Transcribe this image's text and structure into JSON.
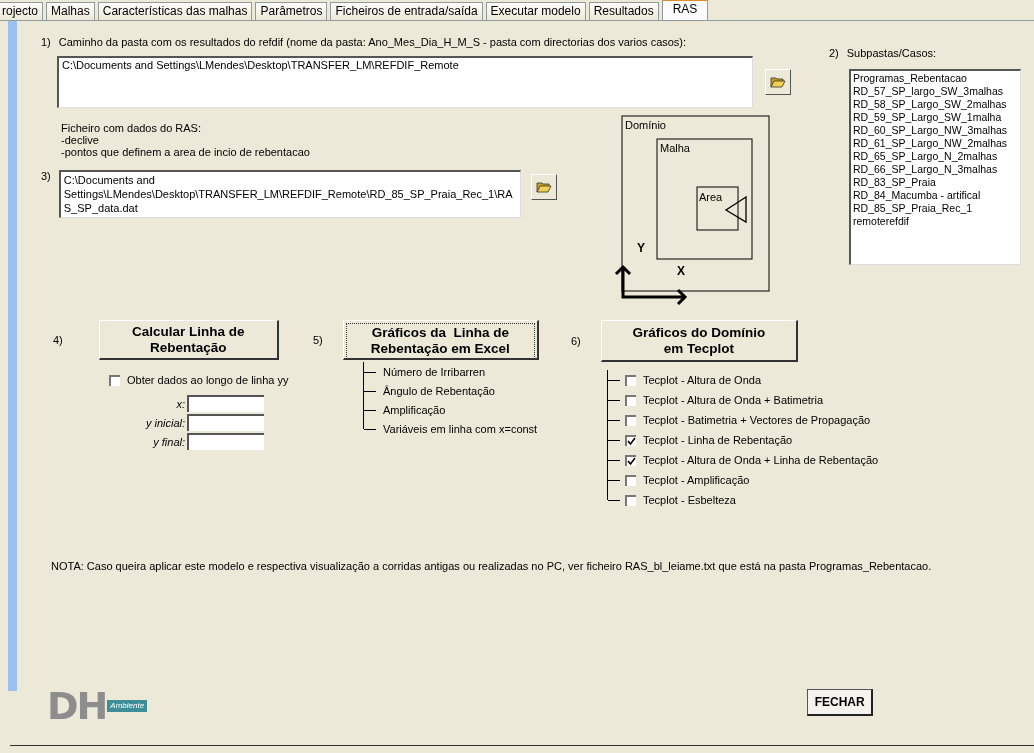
{
  "tabs": [
    {
      "label": "rojecto",
      "selected": false
    },
    {
      "label": "Malhas",
      "selected": false
    },
    {
      "label": "Características das malhas",
      "selected": false
    },
    {
      "label": "Parâmetros",
      "selected": false
    },
    {
      "label": "Ficheiros de entrada/saída",
      "selected": false
    },
    {
      "label": "Executar modelo",
      "selected": false
    },
    {
      "label": "Resultados",
      "selected": false
    },
    {
      "label": "RAS",
      "selected": true
    }
  ],
  "step1": {
    "number": "1)",
    "label": "Caminho da pasta com os resultados do refdif (nome da pasta:  Ano_Mes_Dia_H_M_S - pasta com directorias dos varios casos):",
    "value": "C:\\Documents and Settings\\LMendes\\Desktop\\TRANSFER_LM\\REFDIF_Remote"
  },
  "step2": {
    "number": "2)",
    "label": "Subpastas/Casos:",
    "items": [
      "Programas_Rebentacao",
      "RD_57_SP_largo_SW_3malhas",
      "RD_58_SP_Largo_SW_2malhas",
      "RD_59_SP_Largo_SW_1malha",
      "RD_60_SP_Largo_NW_3malhas",
      "RD_61_SP_Largo_NW_2malhas",
      "RD_65_SP_Largo_N_2malhas",
      "RD_66_SP_Largo_N_3malhas",
      "RD_83_SP_Praia",
      "RD_84_Macumba - artifical",
      "RD_85_SP_Praia_Rec_1",
      "remoterefdif"
    ]
  },
  "ras_file": {
    "lines": [
      "Ficheiro com dados do RAS:",
      "-declive",
      "-pontos que definem a area de incio de rebentacao"
    ]
  },
  "step3": {
    "number": "3)",
    "value": "C:\\Documents and Settings\\LMendes\\Desktop\\TRANSFER_LM\\REFDIF_Remote\\RD_85_SP_Praia_Rec_1\\RAS_SP_data.dat"
  },
  "diagram": {
    "domain": "Domínio",
    "mesh": "Malha",
    "area": "Area",
    "y_axis": "Y",
    "x_axis": "X"
  },
  "step4": {
    "number": "4)",
    "button": "Calcular Linha de Rebentação",
    "checkbox": {
      "label": "Obter dados ao longo de linha yy",
      "checked": false
    },
    "fields": [
      {
        "label": "x:"
      },
      {
        "label": "y inicial:"
      },
      {
        "label": "y final:"
      }
    ]
  },
  "step5": {
    "number": "5)",
    "button": "Gráficos da  Linha de Rebentação em Excel",
    "items": [
      "Número de Irribarren",
      "Ângulo de Rebentação",
      "Amplificação",
      "Variáveis em linha com x=const"
    ]
  },
  "step6": {
    "number": "6)",
    "button": "Gráficos do Domínio em Tecplot",
    "options": [
      {
        "label": "Tecplot - Altura de Onda",
        "checked": false
      },
      {
        "label": "Tecplot - Altura de Onda  + Batimetria",
        "checked": false
      },
      {
        "label": "Tecplot - Batimetria + Vectores de Propagação",
        "checked": false
      },
      {
        "label": "Tecplot - Linha de Rebentação",
        "checked": true
      },
      {
        "label": "Tecplot -  Altura de Onda + Linha de Rebentação",
        "checked": true
      },
      {
        "label": "Tecplot - Amplificação",
        "checked": false
      },
      {
        "label": "Tecplot - Esbelteza",
        "checked": false
      }
    ]
  },
  "note": "NOTA: Caso queira aplicar este modelo e respectiva visualização a corridas antigas ou realizadas no PC, ver ficheiro RAS_bl_leiame.txt que está na pasta Programas_Rebentacao.",
  "logo": {
    "letters": "DH",
    "tag": "Ambiente"
  },
  "close_button": "FECHAR"
}
